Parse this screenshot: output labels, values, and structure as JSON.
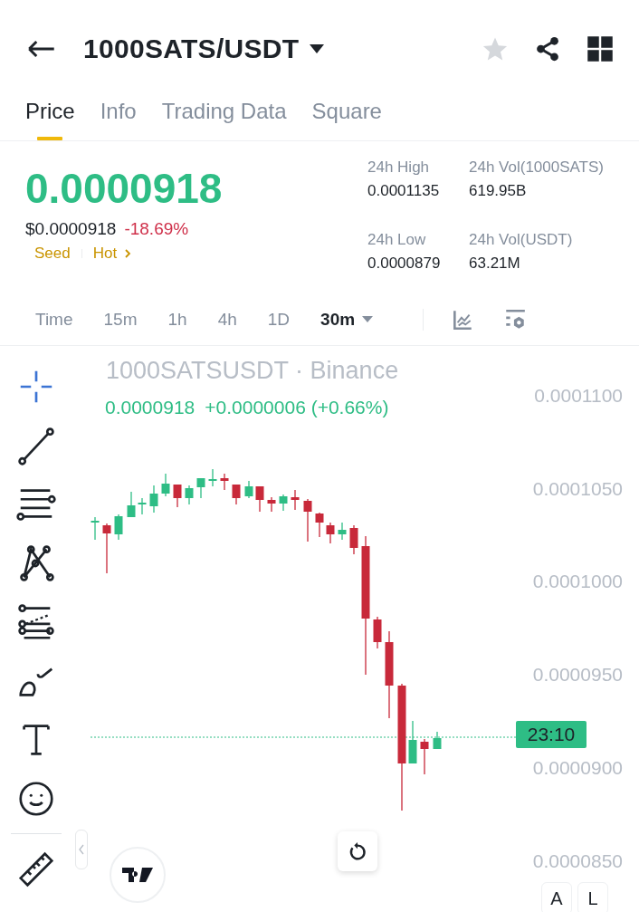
{
  "header": {
    "symbol": "1000SATS/USDT",
    "favorite": false
  },
  "tabs": [
    {
      "label": "Price",
      "selected": true
    },
    {
      "label": "Info",
      "selected": false
    },
    {
      "label": "Trading Data",
      "selected": false
    },
    {
      "label": "Square",
      "selected": false
    }
  ],
  "price": {
    "last": "0.0000918",
    "usd": "$0.0000918",
    "change": "-18.69%",
    "tags": [
      "Seed",
      "Hot"
    ]
  },
  "stats": [
    {
      "label": "24h High",
      "value": "0.0001135"
    },
    {
      "label": "24h Vol(1000SATS)",
      "value": "619.95B"
    },
    {
      "label": "24h Low",
      "value": "0.0000879"
    },
    {
      "label": "24h Vol(USDT)",
      "value": "63.21M"
    }
  ],
  "intervals": [
    {
      "label": "Time",
      "selected": false
    },
    {
      "label": "15m",
      "selected": false
    },
    {
      "label": "1h",
      "selected": false
    },
    {
      "label": "4h",
      "selected": false
    },
    {
      "label": "1D",
      "selected": false
    },
    {
      "label": "30m",
      "selected": true
    }
  ],
  "chart": {
    "title": "1000SATSUSDT · Binance",
    "legend_price": "0.0000918",
    "legend_change": "+0.0000006 (+0.66%)",
    "price_axis": [
      "0.0001100",
      "0.0001050",
      "0.0001000",
      "0.0000950",
      "0.0000900",
      "0.0000850"
    ],
    "countdown": "23:10",
    "scale_buttons": [
      "A",
      "L"
    ]
  }
}
